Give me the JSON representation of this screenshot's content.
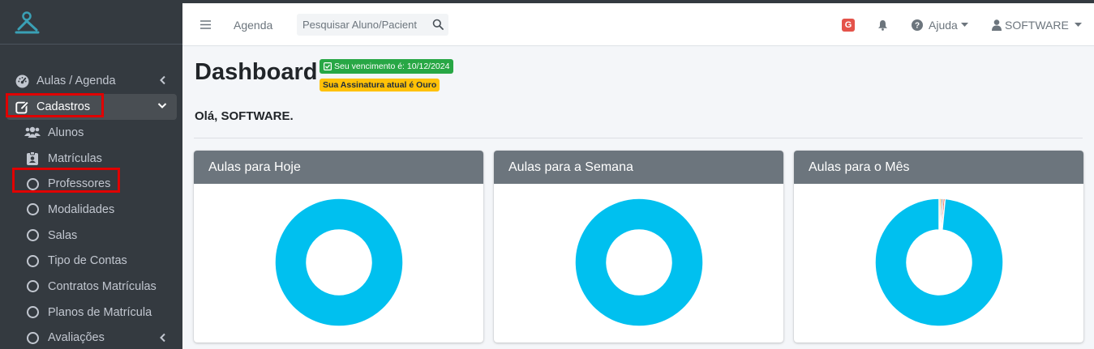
{
  "colors": {
    "sidebar_bg": "#343a40",
    "accent": "#17a2b8",
    "donut": "#00c0ef",
    "highlight": "#e00000",
    "card_header": "#6c757d"
  },
  "sidebar": {
    "logo_icon": "person-logo-icon",
    "items": [
      {
        "label": "Aulas / Agenda",
        "icon": "gauge-icon",
        "chevron": "chevron-left"
      },
      {
        "label": "Cadastros",
        "icon": "edit-icon",
        "chevron": "chevron-down",
        "active": true,
        "highlighted": true
      }
    ],
    "subitems": [
      {
        "label": "Alunos",
        "icon": "users-icon"
      },
      {
        "label": "Matrículas",
        "icon": "id-badge-icon"
      },
      {
        "label": "Professores",
        "icon": "circle-icon",
        "highlighted": true
      },
      {
        "label": "Modalidades",
        "icon": "circle-icon"
      },
      {
        "label": "Salas",
        "icon": "circle-icon"
      },
      {
        "label": "Tipo de Contas",
        "icon": "circle-icon"
      },
      {
        "label": "Contratos Matrículas",
        "icon": "circle-icon"
      },
      {
        "label": "Planos de Matrícula",
        "icon": "circle-icon"
      },
      {
        "label": "Avaliações",
        "icon": "circle-icon",
        "chevron": "chevron-left"
      }
    ]
  },
  "topbar": {
    "menu_icon": "hamburger-icon",
    "agenda_link": "Agenda",
    "search_placeholder": "Pesquisar Aluno/Pacient",
    "g_badge": "G",
    "help_label": "Ajuda",
    "user_label": "SOFTWARE"
  },
  "dashboard": {
    "title": "Dashboard",
    "due_badge": "Seu vencimento é: 10/12/2024",
    "plan_badge": "Sua Assinatura atual é Ouro",
    "greeting": "Olá, SOFTWARE."
  },
  "cards": [
    {
      "title": "Aulas para Hoje"
    },
    {
      "title": "Aulas para a Semana"
    },
    {
      "title": "Aulas para o Mês"
    }
  ],
  "chart_data": [
    {
      "type": "pie",
      "title": "Aulas para Hoje",
      "slices": [
        {
          "value": 100,
          "color": "#00c0ef"
        }
      ]
    },
    {
      "type": "pie",
      "title": "Aulas para a Semana",
      "slices": [
        {
          "value": 100,
          "color": "#00c0ef"
        }
      ]
    },
    {
      "type": "pie",
      "title": "Aulas para o Mês",
      "slices": [
        {
          "value": 0.5,
          "color": "#f39c12"
        },
        {
          "value": 0.5,
          "color": "#6c757d"
        },
        {
          "value": 0.5,
          "color": "#dd4b39"
        },
        {
          "value": 98.5,
          "color": "#00c0ef"
        }
      ]
    }
  ]
}
